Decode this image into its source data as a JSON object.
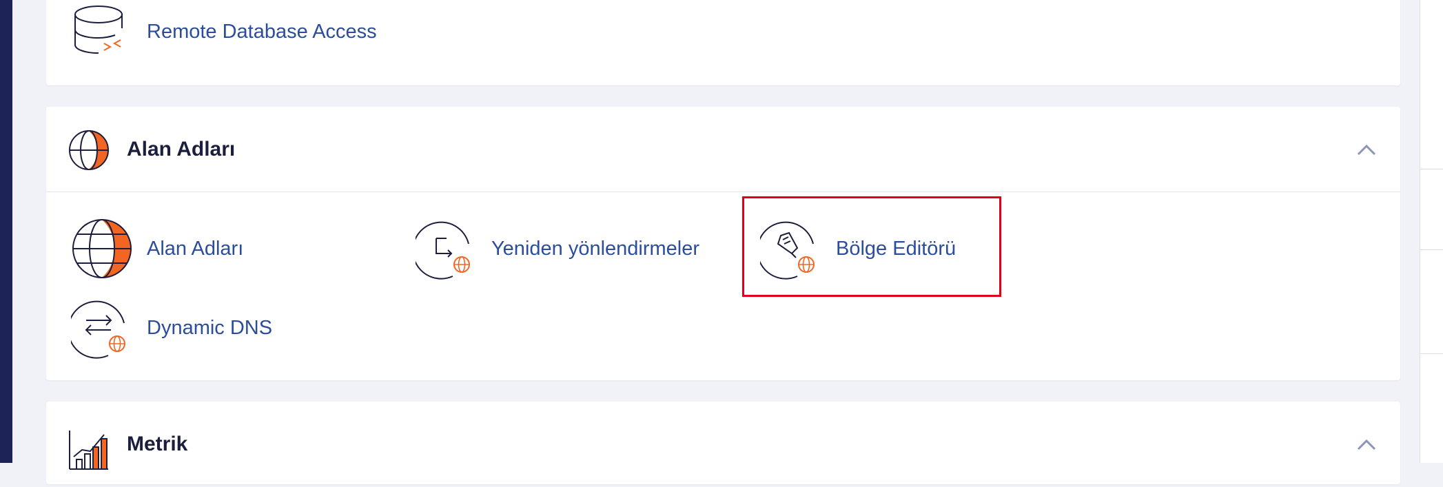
{
  "database_section": {
    "items": [
      {
        "label": "Remote Database Access",
        "icon": "database-remote-icon"
      }
    ]
  },
  "domains_section": {
    "title": "Alan Adları",
    "icon": "globe-icon",
    "collapse_icon": "chevron-up-icon",
    "items": [
      {
        "label": "Alan Adları",
        "icon": "globe-icon"
      },
      {
        "label": "Yeniden yönlendirmeler",
        "icon": "redirect-icon"
      },
      {
        "label": "Bölge Editörü",
        "icon": "zone-editor-icon"
      },
      {
        "label": "Dynamic DNS",
        "icon": "dynamic-dns-icon"
      }
    ]
  },
  "metrics_section": {
    "title": "Metrik",
    "icon": "bar-chart-icon",
    "collapse_icon": "chevron-up-icon"
  },
  "colors": {
    "accent": "#f26522",
    "link": "#2b4d9b",
    "highlight": "#e0001b",
    "nav": "#1e2357"
  }
}
